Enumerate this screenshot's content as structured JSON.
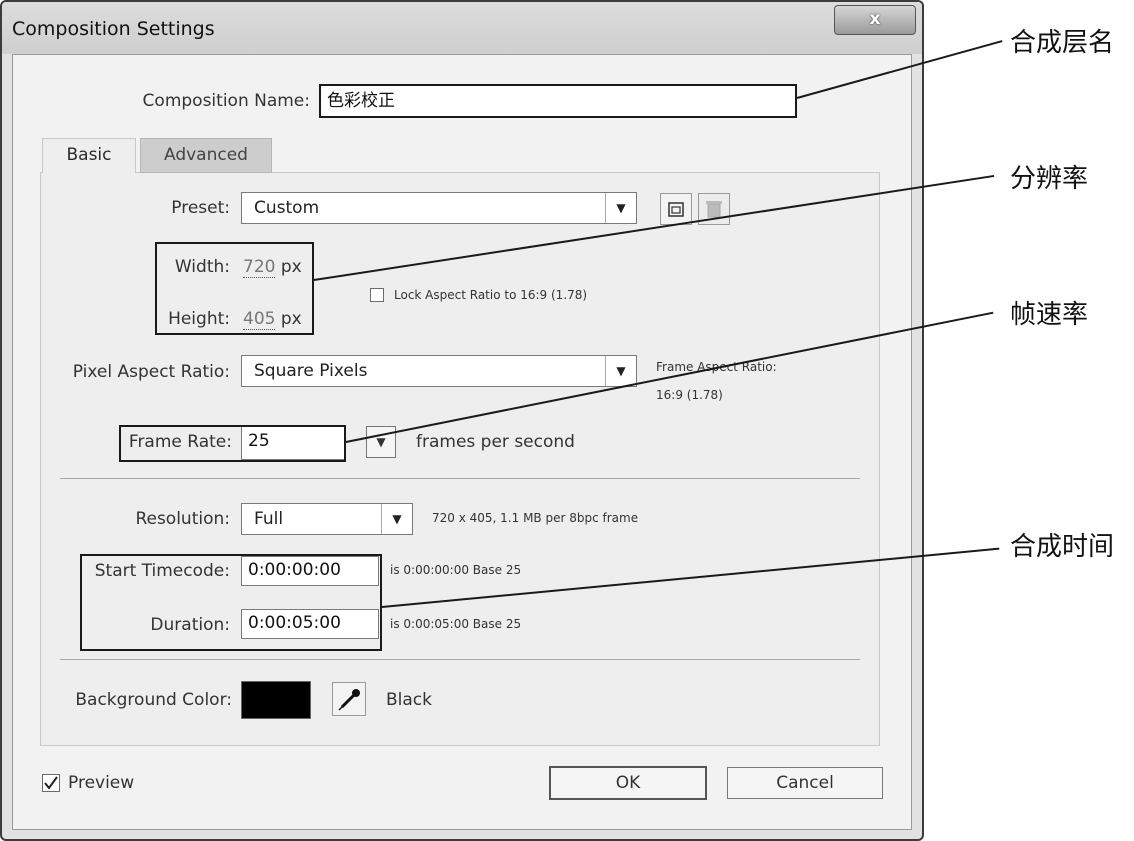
{
  "window": {
    "title": "Composition Settings",
    "close_symbol": "x"
  },
  "composition_name": {
    "label": "Composition Name:",
    "value": "色彩校正"
  },
  "tabs": [
    {
      "label": "Basic"
    },
    {
      "label": "Advanced"
    }
  ],
  "preset": {
    "label": "Preset:",
    "value": "Custom"
  },
  "width": {
    "label": "Width:",
    "value": "720",
    "unit": "px"
  },
  "height": {
    "label": "Height:",
    "value": "405",
    "unit": "px"
  },
  "lock_aspect": {
    "label": "Lock Aspect Ratio to 16:9 (1.78)",
    "checked": false
  },
  "pixel_aspect": {
    "label": "Pixel Aspect Ratio:",
    "value": "Square Pixels"
  },
  "frame_aspect": {
    "line1": "Frame Aspect Ratio:",
    "line2": "16:9 (1.78)"
  },
  "frame_rate": {
    "label": "Frame Rate:",
    "value": "25",
    "suffix": "frames per second"
  },
  "resolution": {
    "label": "Resolution:",
    "value": "Full",
    "info": "720 x 405, 1.1 MB per 8bpc frame"
  },
  "start_timecode": {
    "label": "Start Timecode:",
    "value": "0:00:00:00",
    "info": "is 0:00:00:00  Base 25"
  },
  "duration": {
    "label": "Duration:",
    "value": "0:00:05:00",
    "info": "is 0:00:05:00  Base 25"
  },
  "background": {
    "label": "Background Color:",
    "color_name": "Black",
    "swatch": "#000000"
  },
  "preview": {
    "label": "Preview",
    "checked": true
  },
  "buttons": {
    "ok": "OK",
    "cancel": "Cancel"
  },
  "annotations": {
    "comp_name": "合成层名",
    "resolution": "分辨率",
    "frame_rate": "帧速率",
    "comp_time": "合成时间"
  }
}
